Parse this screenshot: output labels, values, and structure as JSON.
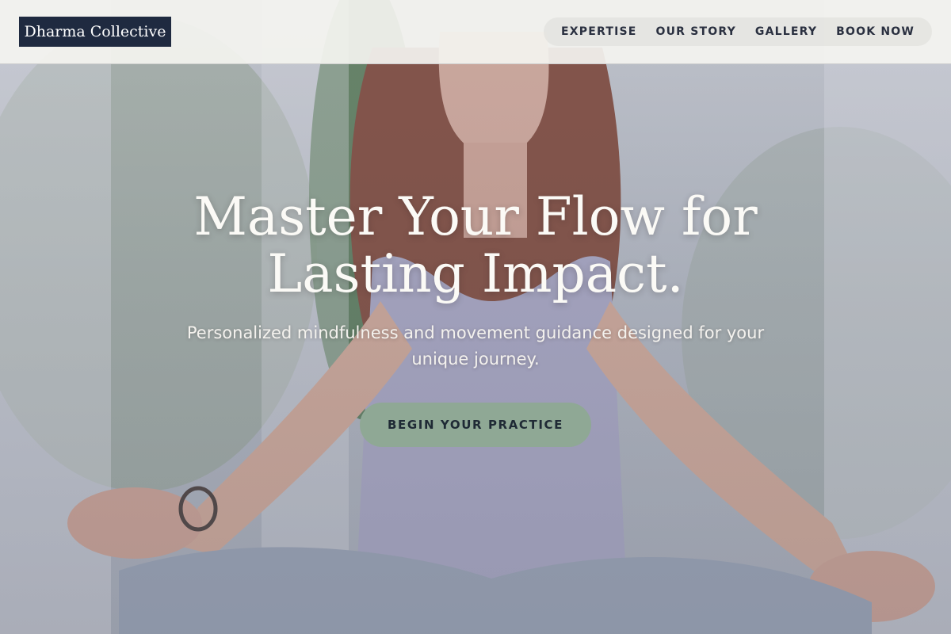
{
  "brand": {
    "logo_text": "Dharma Collective"
  },
  "nav": {
    "items": [
      {
        "label": "EXPERTISE"
      },
      {
        "label": "OUR STORY"
      },
      {
        "label": "GALLERY"
      },
      {
        "label": "BOOK NOW"
      }
    ]
  },
  "hero": {
    "headline_line1": "Master Your Flow for",
    "headline_line2": "Lasting Impact.",
    "subtitle": "Personalized mindfulness and movement guidance designed for your unique journey.",
    "cta_label": "BEGIN YOUR PRACTICE",
    "background_description": "woman meditating in lotus pose"
  },
  "colors": {
    "logo_bg": "#1f2a40",
    "header_bg": "#f4f4f0",
    "nav_pill_bg": "#e1e1de",
    "cta_bg": "#8fa895",
    "cta_text": "#1f2a35",
    "headline_text": "#fbfaf6"
  }
}
